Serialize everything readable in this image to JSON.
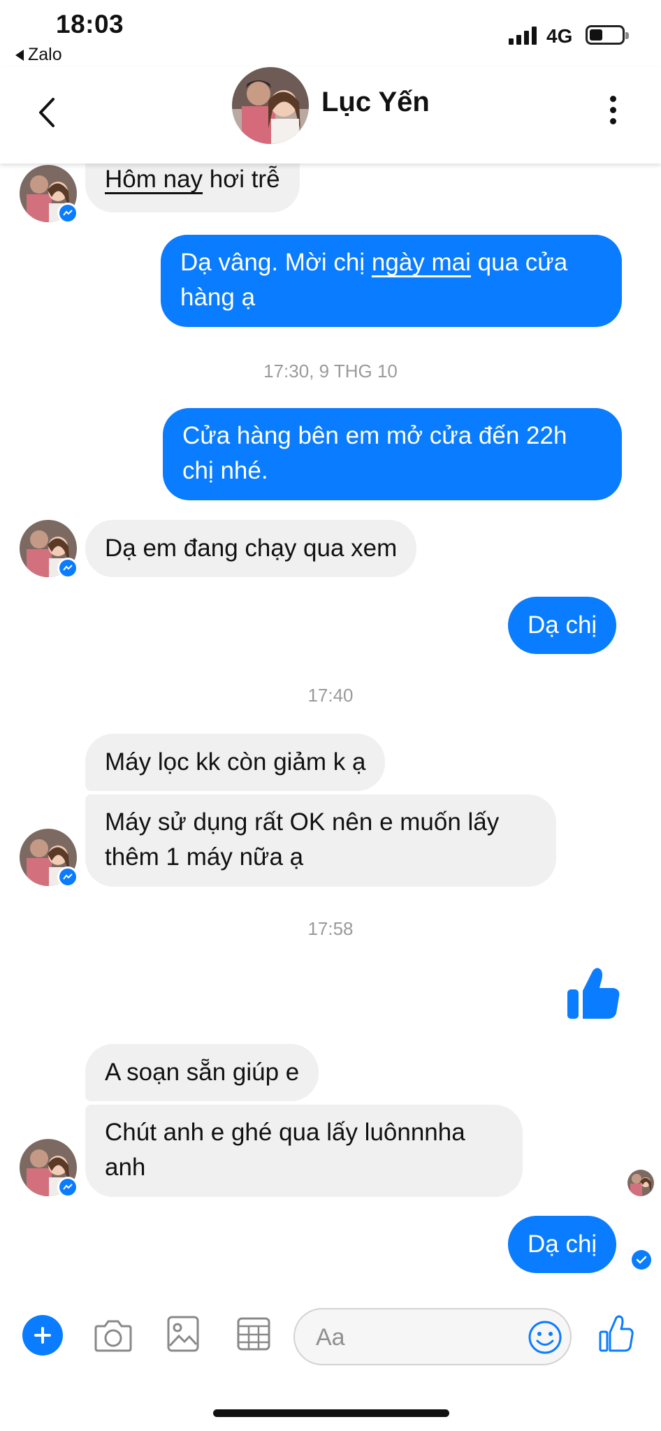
{
  "status_bar": {
    "time": "18:03",
    "back_app": "Zalo",
    "network": "4G"
  },
  "header": {
    "contact_name": "Lục Yến"
  },
  "messages": {
    "m1_part1": "Hôm nay",
    "m1_part2": " hơi trễ",
    "m2_line1_a": "Dạ vâng. Mời chị ",
    "m2_line1_link": "ngày mai",
    "m2_line1_b": " qua cửa",
    "m2_line2": "hàng ạ",
    "ts1": "17:30, 9 THG 10",
    "m3_line1": "Cửa hàng bên em mở cửa đến 22h",
    "m3_line2": "chị nhé.",
    "m4": "Dạ em đang chạy qua xem",
    "m5": "Dạ chị",
    "ts2": "17:40",
    "m6": "Máy lọc kk còn giảm k ạ",
    "m7_line1": "Máy sử dụng rất OK nên e muốn lấy",
    "m7_line2": "thêm 1 máy nữa ạ",
    "ts3": "17:58",
    "m8": "A soạn sẵn giúp e",
    "m9_line1": "Chút anh e ghé qua lấy luônnnha",
    "m9_line2": "anh",
    "m10": "Dạ chị"
  },
  "composer": {
    "placeholder": "Aa"
  },
  "colors": {
    "accent": "#0a7cff",
    "incoming_bubble": "#f0f0f0",
    "timestamp": "#9a9a9a"
  },
  "icons": [
    "zalo-back-triangle",
    "signal-icon",
    "battery-icon",
    "back-chevron-icon",
    "more-options-icon",
    "messenger-badge-icon",
    "thumbs-up-sticker-icon",
    "seen-check-icon",
    "plus-icon",
    "camera-icon",
    "gallery-icon",
    "sticker-grid-icon",
    "emoji-icon",
    "like-icon"
  ]
}
